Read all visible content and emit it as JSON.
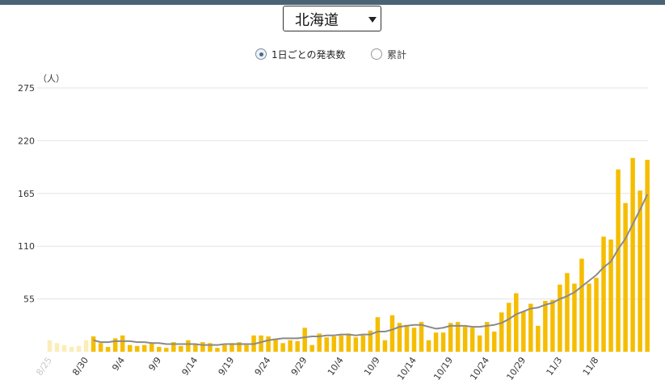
{
  "header": {
    "prefecture": "北海道",
    "options": [
      {
        "label": "1日ごとの発表数",
        "checked": true
      },
      {
        "label": "累計",
        "checked": false
      }
    ]
  },
  "colors": {
    "bar": "#f5bd00",
    "line": "#8a8a8a",
    "grid": "#e3e3e3",
    "topbar": "#4a6476"
  },
  "chart_data": {
    "type": "bar",
    "unit_label": "（人）",
    "ylim": [
      0,
      275
    ],
    "yticks": [
      275,
      220,
      165,
      110,
      55
    ],
    "xtick_labels": [
      "8/25",
      "8/30",
      "9/4",
      "9/9",
      "9/14",
      "9/19",
      "9/24",
      "9/29",
      "10/4",
      "10/9",
      "10/14",
      "10/19",
      "10/24",
      "10/29",
      "11/3",
      "11/8"
    ],
    "x_start": "8/25",
    "series": [
      {
        "type": "bar",
        "values": [
          12,
          9,
          7,
          5,
          6,
          12,
          16,
          9,
          5,
          14,
          17,
          7,
          6,
          7,
          9,
          5,
          4,
          10,
          6,
          12,
          8,
          10,
          9,
          4,
          7,
          9,
          10,
          7,
          17,
          17,
          16,
          13,
          9,
          12,
          11,
          25,
          7,
          19,
          15,
          16,
          17,
          19,
          15,
          17,
          22,
          36,
          12,
          38,
          30,
          28,
          25,
          31,
          12,
          20,
          20,
          30,
          31,
          26,
          25,
          17,
          31,
          21,
          41,
          51,
          61,
          42,
          50,
          27,
          53,
          54,
          70,
          82,
          71,
          97,
          71,
          77,
          120,
          117,
          190,
          155,
          202,
          168,
          200
        ],
        "faded_count": 6
      },
      {
        "type": "line",
        "values": [
          null,
          null,
          null,
          null,
          null,
          null,
          12,
          10,
          10,
          11,
          11,
          11,
          10,
          10,
          9,
          9,
          8,
          8,
          8,
          8,
          8,
          7,
          7,
          7,
          8,
          8,
          8,
          8,
          8,
          10,
          12,
          13,
          14,
          14,
          14,
          15,
          16,
          16,
          17,
          17,
          18,
          18,
          17,
          18,
          18,
          21,
          21,
          23,
          26,
          27,
          28,
          28,
          26,
          24,
          25,
          27,
          27,
          27,
          26,
          26,
          27,
          28,
          30,
          34,
          39,
          42,
          45,
          46,
          49,
          51,
          55,
          58,
          62,
          68,
          74,
          80,
          88,
          94,
          107,
          118,
          133,
          148,
          164
        ]
      }
    ]
  }
}
